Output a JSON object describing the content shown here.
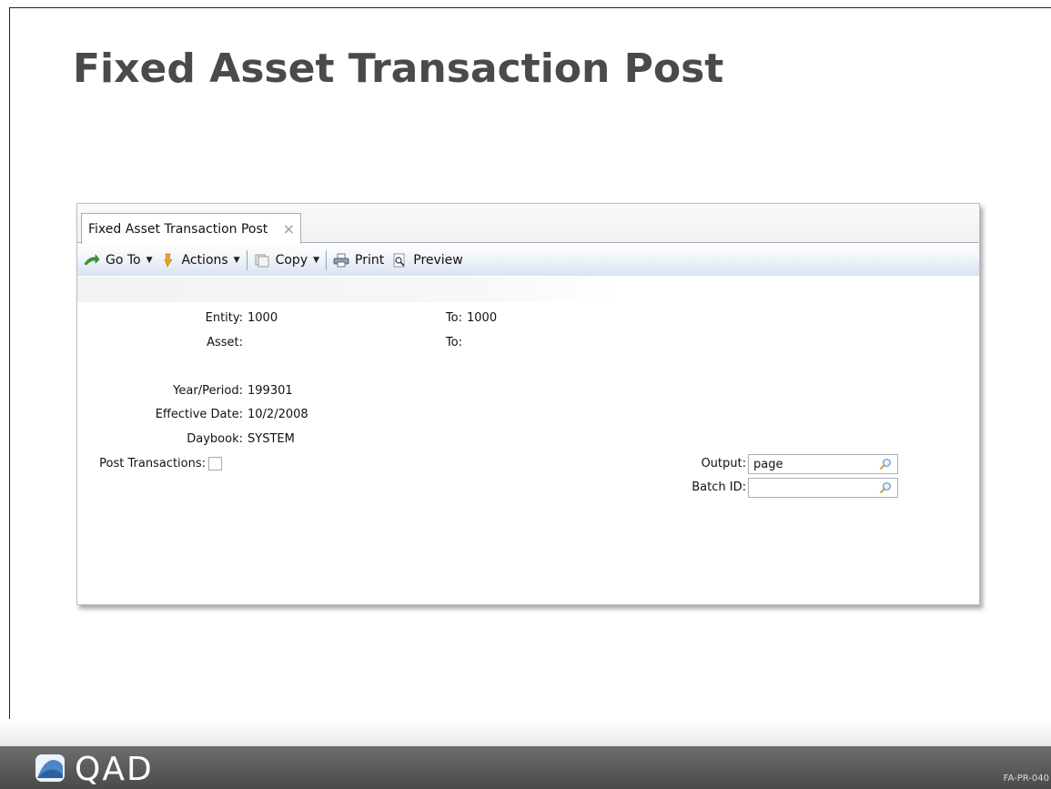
{
  "slide": {
    "title": "Fixed Asset Transaction Post",
    "code": "FA-PR-040",
    "logo_text": "QAD"
  },
  "window": {
    "tab_label": "Fixed Asset Transaction Post",
    "tab_close": "×"
  },
  "toolbar": {
    "goto_label": "Go To",
    "actions_label": "Actions",
    "copy_label": "Copy",
    "print_label": "Print",
    "preview_label": "Preview",
    "dropdown_caret": "▼",
    "icons": [
      "goto-arrow-icon",
      "actions-pointer-icon",
      "copy-icon",
      "printer-icon",
      "preview-icon"
    ]
  },
  "form": {
    "entity_label": "Entity:",
    "entity_value": "1000",
    "entity_to_label": "To:",
    "entity_to_value": "1000",
    "asset_label": "Asset:",
    "asset_value": "",
    "asset_to_label": "To:",
    "asset_to_value": "",
    "year_period_label": "Year/Period:",
    "year_period_value": "199301",
    "effective_date_label": "Effective Date:",
    "effective_date_value": "10/2/2008",
    "daybook_label": "Daybook:",
    "daybook_value": "SYSTEM",
    "post_transactions_label": "Post Transactions:",
    "post_transactions_checked": false,
    "output_label": "Output:",
    "output_value": "page",
    "batch_id_label": "Batch ID:",
    "batch_id_value": ""
  },
  "colors": {
    "title": "#4a4a4a",
    "toolbar_gradient_end": "#d9e3f2",
    "footer": "#555555"
  }
}
